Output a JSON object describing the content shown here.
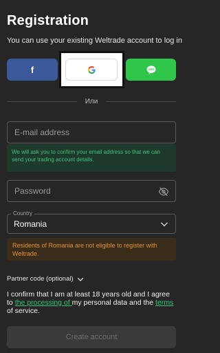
{
  "header": {
    "title": "Registration",
    "subtitle": "You can use your existing Weltrade account to log in"
  },
  "social": {
    "facebook_label": "f",
    "google_label": "G",
    "line_label": "LINE",
    "colors": {
      "facebook": "#3b5998",
      "google": "#ffffff",
      "line": "#2fc64a"
    }
  },
  "divider": {
    "label": "Или"
  },
  "email": {
    "placeholder": "E-mail address",
    "value": "",
    "hint": "We will ask you to confirm your email address so that we can send your trading account details."
  },
  "password": {
    "placeholder": "Password",
    "value": "",
    "toggle_icon": "eye-off-icon"
  },
  "country": {
    "label": "Country",
    "value": "Romania",
    "warning": "Residents of Romania are not eligible to register with Weltrade."
  },
  "partner": {
    "label": "Partner code (optional)"
  },
  "consent": {
    "part1": "I confirm that I am at least 18 years old and I agree to ",
    "link1": "the processing of ",
    "part2": "my personal data and the ",
    "link2": "terms",
    "part3": " of service."
  },
  "submit": {
    "label": "Create account"
  },
  "colors": {
    "background": "#262626",
    "accent_green": "#35c27b",
    "warning_orange": "#e0922c"
  }
}
